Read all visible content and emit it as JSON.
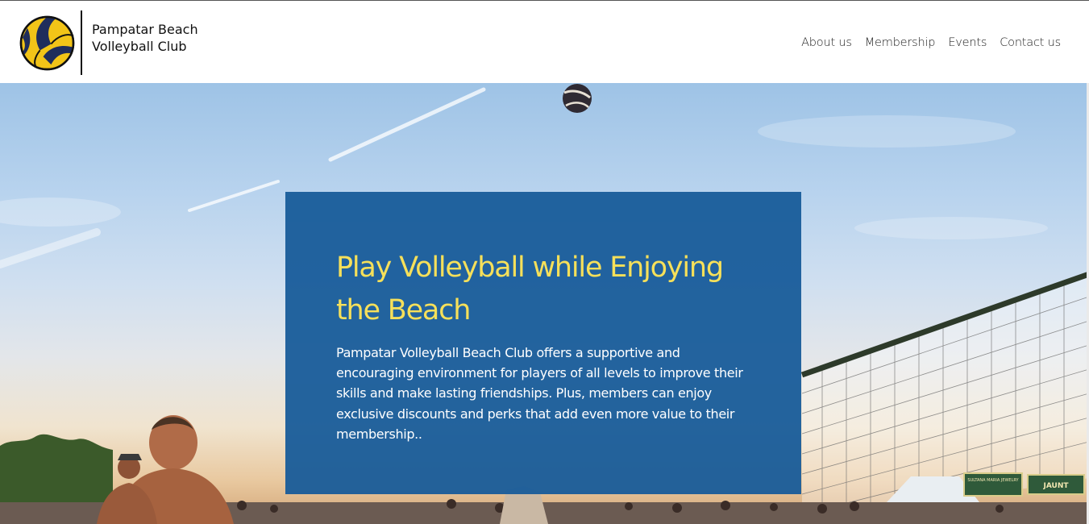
{
  "header": {
    "brand_name": "Pampatar Beach Volleyball Club",
    "logo_icon": "volleyball-logo-icon",
    "nav": [
      {
        "label": "About us"
      },
      {
        "label": "Membership"
      },
      {
        "label": "Events"
      },
      {
        "label": "Contact us"
      }
    ]
  },
  "hero": {
    "background": "beach-volleyball-photo",
    "title": "Play Volleyball while  Enjoying the  Beach",
    "body": "Pampatar Volleyball  Beach Club offers a supportive and encouraging environment for players of all levels to improve their skills and make lasting friendships.  Plus, members can enjoy exclusive discounts and perks that add even more value to their membership..",
    "net_signs": [
      "SULTANA MARIA JEWELRY",
      "JAUNT"
    ]
  },
  "colors": {
    "card_bg": "#165a99",
    "title": "#f6e05a",
    "body_text": "#ffffff",
    "logo_navy": "#1f2d5c",
    "logo_yellow": "#f2c418"
  }
}
